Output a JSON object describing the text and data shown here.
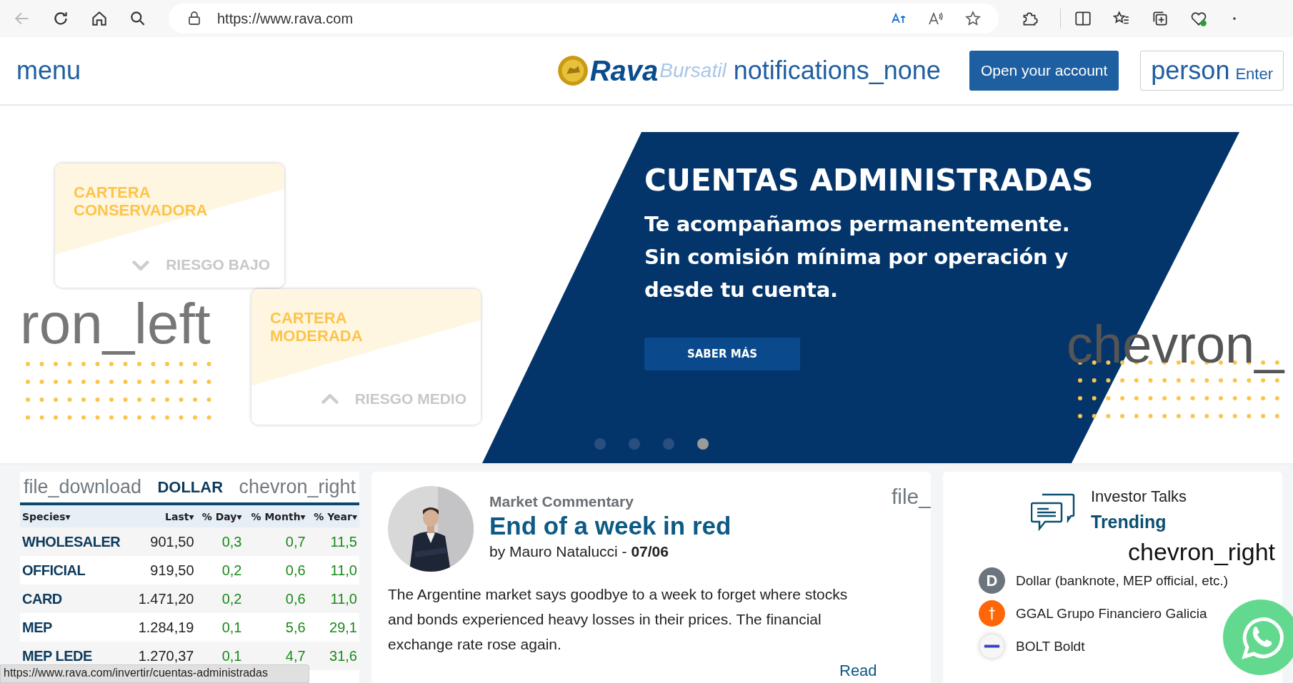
{
  "browser": {
    "url": "https://www.rava.com"
  },
  "header": {
    "menu": "menu",
    "logo": "Rava",
    "logo_sub": "Bursatil",
    "notifications": "notifications_none",
    "open_account": "Open your account",
    "person": "person",
    "enter": "Enter"
  },
  "banner": {
    "prev": "ron_left",
    "next": "chevron_",
    "cards": [
      {
        "title": "CARTERA CONSERVADORA",
        "risk": "RIESGO BAJO",
        "kind": "low"
      },
      {
        "title": "CARTERA MODERADA",
        "risk": "RIESGO MEDIO",
        "kind": "medium"
      }
    ],
    "heading": "CUENTAS ADMINISTRADAS",
    "text": "Te acompañamos permanentemente.\nSin comisión mínima por operación y\ndesde tu cuenta.",
    "button": "SABER MÁS",
    "slides": [
      {
        "selected": false
      },
      {
        "selected": false
      },
      {
        "selected": false
      },
      {
        "selected": true
      }
    ]
  },
  "dollar": {
    "download": "file_download",
    "title": "DOLLAR",
    "next": "chevron_right",
    "columns": [
      "Species▾",
      "Last▾",
      "% Day▾",
      "% Month▾",
      "% Year▾"
    ],
    "rows": [
      {
        "name": "WHOLESALER",
        "last": "901,50",
        "day": "0,3",
        "month": "0,7",
        "year": "11,5"
      },
      {
        "name": "OFFICIAL",
        "last": "919,50",
        "day": "0,2",
        "month": "0,6",
        "year": "11,0"
      },
      {
        "name": "CARD",
        "last": "1.471,20",
        "day": "0,2",
        "month": "0,6",
        "year": "11,0"
      },
      {
        "name": "MEP",
        "last": "1.284,19",
        "day": "0,1",
        "month": "5,6",
        "year": "29,1"
      },
      {
        "name": "MEP LEDE",
        "last": "1.270,37",
        "day": "0,1",
        "month": "4,7",
        "year": "31,6"
      }
    ]
  },
  "commentary": {
    "category": "Market Commentary",
    "title": "End of a week in red",
    "byline": "by Mauro Natalucci - **07/06**",
    "download": "file_",
    "body": "The Argentine market says goodbye to a week to forget where stocks and bonds experienced heavy losses in their prices. The financial exchange rate rose again.",
    "read": "Read"
  },
  "talks": {
    "title": "Investor Talks",
    "subtitle": "Trending",
    "next": "chevron_right",
    "items": [
      {
        "kind": "letter",
        "badge": "D",
        "label": "Dollar (banknote, MEP official, etc.)"
      },
      {
        "kind": "cross",
        "label": "GGAL Grupo Financiero Galicia"
      },
      {
        "kind": "logo",
        "label": "BOLT Boldt"
      }
    ]
  },
  "status_bar": "https://www.rava.com/invertir/cuentas-administradas"
}
